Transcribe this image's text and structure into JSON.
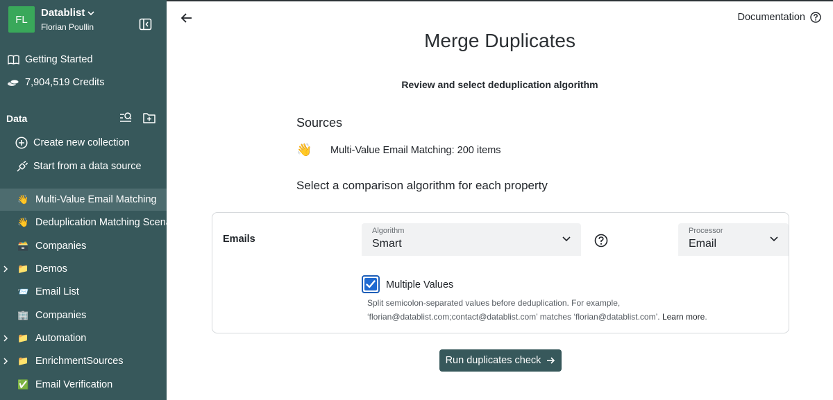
{
  "sidebar": {
    "workspace": {
      "initials": "FL",
      "name": "Datablist",
      "user": "Florian Poullin"
    },
    "links": [
      {
        "label": "Getting Started",
        "icon": "book-icon"
      },
      {
        "label": "7,904,519 Credits",
        "icon": "coins-icon"
      }
    ],
    "section_title": "Data",
    "actions": [
      {
        "label": "Create new collection",
        "icon": "plus-circle-icon"
      },
      {
        "label": "Start from a data source",
        "icon": "plug-icon"
      }
    ],
    "collections": [
      {
        "label": "Multi-Value Email Matching",
        "emoji": "👋",
        "active": true,
        "folder": false
      },
      {
        "label": "Deduplication Matching Scenarios",
        "emoji": "👋",
        "active": false,
        "folder": false
      },
      {
        "label": "Companies",
        "emoji": "🗃️",
        "active": false,
        "folder": false
      },
      {
        "label": "Demos",
        "emoji": "📁",
        "active": false,
        "folder": true
      },
      {
        "label": "Email List",
        "emoji": "📨",
        "active": false,
        "folder": false
      },
      {
        "label": "Companies",
        "emoji": "🏢",
        "active": false,
        "folder": false
      },
      {
        "label": "Automation",
        "emoji": "📁",
        "active": false,
        "folder": true
      },
      {
        "label": "EnrichmentSources",
        "emoji": "📁",
        "active": false,
        "folder": true
      },
      {
        "label": "Email Verification",
        "emoji": "✅",
        "active": false,
        "folder": false
      }
    ]
  },
  "header": {
    "documentation": "Documentation"
  },
  "main": {
    "title": "Merge Duplicates",
    "subtitle": "Review and select deduplication algorithm",
    "sources_heading": "Sources",
    "source": {
      "emoji": "👋",
      "text": "Multi-Value Email Matching: 200 items"
    },
    "algo_heading": "Select a comparison algorithm for each property",
    "property": {
      "name": "Emails",
      "algorithm_caption": "Algorithm",
      "algorithm_value": "Smart",
      "processor_caption": "Processor",
      "processor_value": "Email",
      "multiple_values_label": "Multiple Values",
      "multiple_values_checked": true,
      "help_text": "Split semicolon-separated values before deduplication. For example, ‘florian@datablist.com;contact@datablist.com’ matches ‘florian@datablist.com’.",
      "learn_more": "Learn more",
      "learn_more_suffix": "."
    },
    "run_button": "Run duplicates check"
  },
  "colors": {
    "sidebar_bg": "#37585b",
    "sidebar_active": "#4d6c6f",
    "avatar_bg": "#39a85a",
    "primary_button": "#37585b",
    "checkbox_blue": "#1f6ad1"
  }
}
